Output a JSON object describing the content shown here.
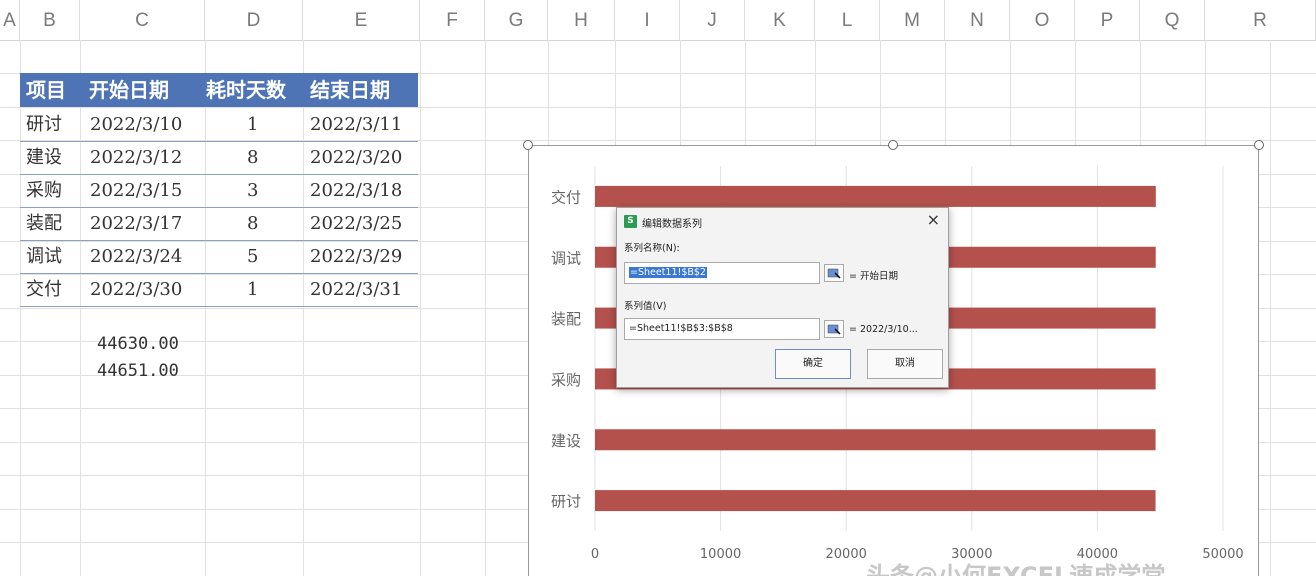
{
  "columns": [
    "A",
    "B",
    "C",
    "D",
    "E",
    "F",
    "G",
    "H",
    "I",
    "J",
    "K",
    "L",
    "M",
    "N",
    "O",
    "P",
    "Q",
    "R"
  ],
  "table": {
    "headers": [
      "项目",
      "开始日期",
      "耗时天数",
      "结束日期"
    ],
    "rows": [
      {
        "item": "研讨",
        "start": "2022/3/10",
        "days": "1",
        "end": "2022/3/11"
      },
      {
        "item": "建设",
        "start": "2022/3/12",
        "days": "8",
        "end": "2022/3/20"
      },
      {
        "item": "采购",
        "start": "2022/3/15",
        "days": "3",
        "end": "2022/3/18"
      },
      {
        "item": "装配",
        "start": "2022/3/17",
        "days": "8",
        "end": "2022/3/25"
      },
      {
        "item": "调试",
        "start": "2022/3/24",
        "days": "5",
        "end": "2022/3/29"
      },
      {
        "item": "交付",
        "start": "2022/3/30",
        "days": "1",
        "end": "2022/3/31"
      }
    ]
  },
  "extra_values": [
    "44630.00",
    "44651.00"
  ],
  "chart_data": {
    "type": "bar",
    "orientation": "horizontal",
    "categories": [
      "研讨",
      "建设",
      "采购",
      "装配",
      "调试",
      "交付"
    ],
    "series": [
      {
        "values": [
          44630,
          44632,
          44635,
          44637,
          44644,
          44650
        ]
      }
    ],
    "xlim": [
      0,
      50000
    ],
    "xticks": [
      "0",
      "10000",
      "20000",
      "30000",
      "40000",
      "50000"
    ],
    "bar_color": "#b5514d",
    "grid": true
  },
  "dialog": {
    "title": "编辑数据系列",
    "name_label": "系列名称(N):",
    "name_value": "=Sheet11!$B$2",
    "name_preview": "= 开始日期",
    "values_label": "系列值(V)",
    "values_value": "=Sheet11!$B$3:$B$8",
    "values_preview": "= 2022/3/10...",
    "ok_label": "确定",
    "cancel_label": "取消",
    "close_glyph": "×",
    "icon_glyph": "S"
  },
  "watermark": "头条@小何EXCEL速成学堂"
}
